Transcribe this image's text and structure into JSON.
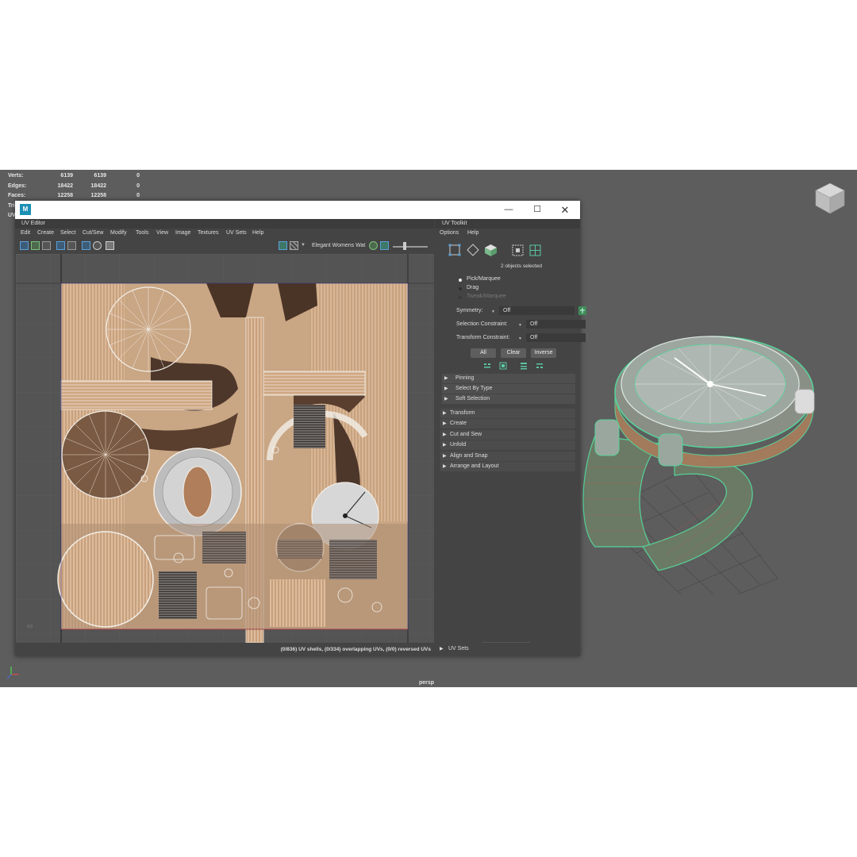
{
  "hud": {
    "rows": [
      {
        "label": "Verts:",
        "v1": "6139",
        "v2": "6139",
        "v3": "0"
      },
      {
        "label": "Edges:",
        "v1": "18422",
        "v2": "18422",
        "v3": "0"
      },
      {
        "label": "Faces:",
        "v1": "12258",
        "v2": "12258",
        "v3": "0"
      }
    ],
    "partial_labels": [
      "Tri",
      "UV"
    ]
  },
  "viewport": {
    "camera_label": "persp"
  },
  "uv_editor": {
    "panel_title": "UV Editor",
    "menu": [
      "Edit",
      "Create",
      "Select",
      "Cut/Sew",
      "Modify",
      "Tools",
      "View",
      "Image",
      "Textures",
      "UV Sets",
      "Help"
    ],
    "texture_name": "Elegant Womens Wat",
    "status": "(0/836) UV shells, (0/334) overlapping UVs, (0/0) reversed UVs",
    "corner_label": "0,0"
  },
  "uv_toolkit": {
    "panel_title": "UV Toolkit",
    "menu": [
      "Options",
      "Help"
    ],
    "selection_info": "2 objects selected",
    "modes": [
      {
        "label": "Pick/Marquee",
        "selected": true,
        "enabled": true
      },
      {
        "label": "Drag",
        "selected": false,
        "enabled": true
      },
      {
        "label": "Tweak/Marquee",
        "selected": false,
        "enabled": false
      }
    ],
    "symmetry": {
      "label": "Symmetry:",
      "value": "Off"
    },
    "selection_constraint": {
      "label": "Selection Constraint:",
      "value": "Off"
    },
    "transform_constraint": {
      "label": "Transform Constraint:",
      "value": "Off"
    },
    "buttons": {
      "all": "All",
      "clear": "Clear",
      "inverse": "Inverse"
    },
    "sub_sections": [
      "Pinning",
      "Select By Type",
      "Soft Selection"
    ],
    "sections": [
      "Transform",
      "Create",
      "Cut and Sew",
      "Unfold",
      "Align and Snap",
      "Arrange and Layout"
    ],
    "footer_section": "UV Sets"
  },
  "colors": {
    "viewport_bg": "#5d5d5d",
    "panel_bg": "#444444",
    "wire_green": "#56d39a",
    "texture_base": "#c9a684",
    "accent_blue": "#1b8fb4"
  }
}
